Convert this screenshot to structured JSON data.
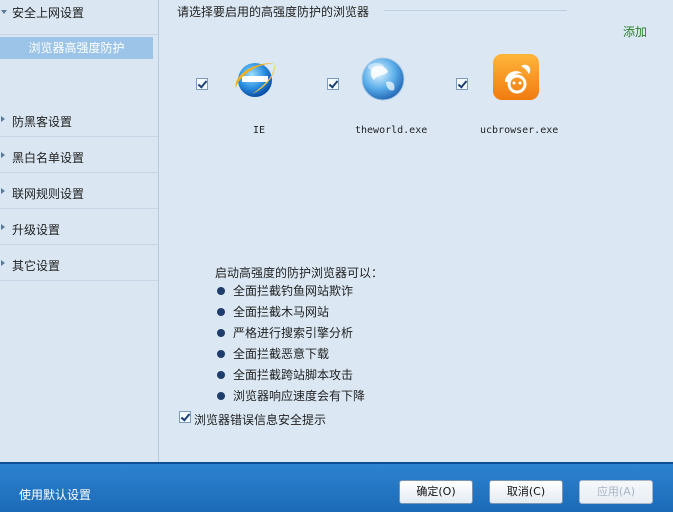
{
  "sidebar": {
    "items": [
      {
        "label": "安全上网设置",
        "expanded": true,
        "sub": "浏览器高强度防护"
      },
      {
        "label": "防黑客设置"
      },
      {
        "label": "黑白名单设置"
      },
      {
        "label": "联网规则设置"
      },
      {
        "label": "升级设置"
      },
      {
        "label": "其它设置"
      }
    ]
  },
  "main": {
    "title": "请选择要启用的高强度防护的浏览器",
    "add_link": "添加",
    "browsers": [
      {
        "name": "IE",
        "icon": "ie-icon",
        "checked": true
      },
      {
        "name": "theworld.exe",
        "icon": "theworld-icon",
        "checked": true
      },
      {
        "name": "ucbrowser.exe",
        "icon": "ucbrowser-icon",
        "checked": true
      }
    ],
    "info_title": "启动高强度的防护浏览器可以：",
    "bullets": [
      "全面拦截钓鱼网站欺诈",
      "全面拦截木马网站",
      "严格进行搜索引擎分析",
      "全面拦截恶意下载",
      "全面拦截跨站脚本攻击",
      "浏览器响应速度会有下降"
    ],
    "warning_checkbox": {
      "label": "浏览器错误信息安全提示",
      "checked": true
    }
  },
  "footer": {
    "default_link": "使用默认设置",
    "ok_label": "确定(O)",
    "cancel_label": "取消(C)",
    "apply_label": "应用(A)",
    "apply_enabled": false
  },
  "colors": {
    "accent": "#1b6ab8",
    "selected": "#9cc4e8",
    "link_green": "#2c7d2c"
  }
}
